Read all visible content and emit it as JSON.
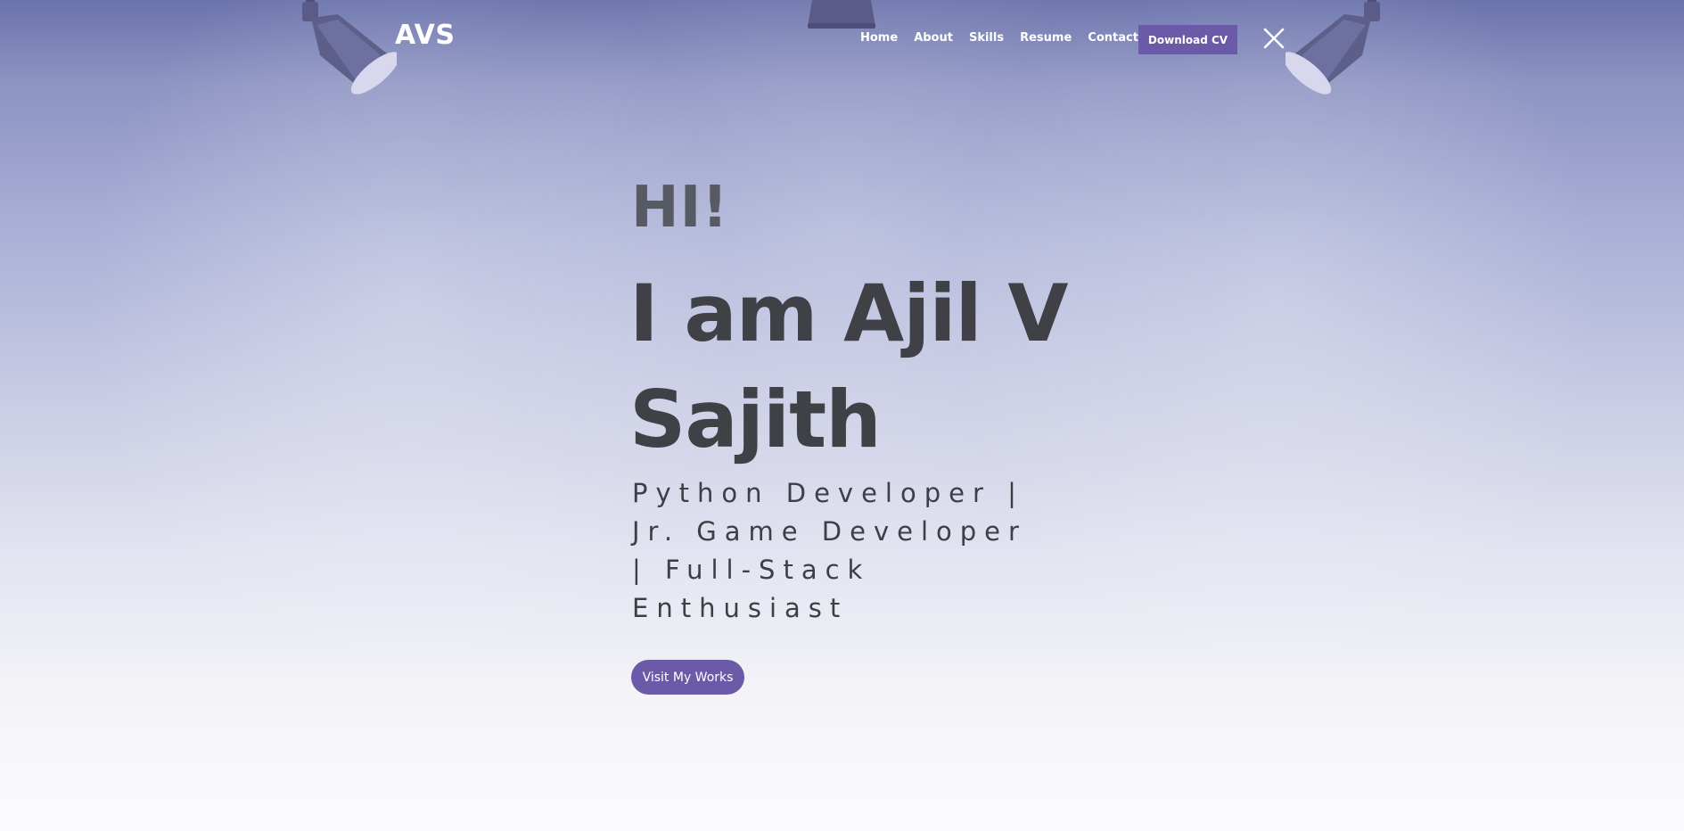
{
  "header": {
    "brand": "AVS",
    "nav": [
      {
        "label": "Home"
      },
      {
        "label": "About"
      },
      {
        "label": "Skills"
      },
      {
        "label": "Resume"
      },
      {
        "label": "Contact"
      }
    ],
    "download_cv": "Download CV",
    "close_icon": "close-icon"
  },
  "hero": {
    "greeting": "HI!",
    "name": "I am Ajil V Sajith",
    "role": "Python Developer | Jr. Game Developer | Full-Stack Enthusiast",
    "cta": "Visit My Works"
  },
  "colors": {
    "accent": "#6a5aa7",
    "heading": "#3f4147",
    "nav_text": "#ffffff"
  }
}
